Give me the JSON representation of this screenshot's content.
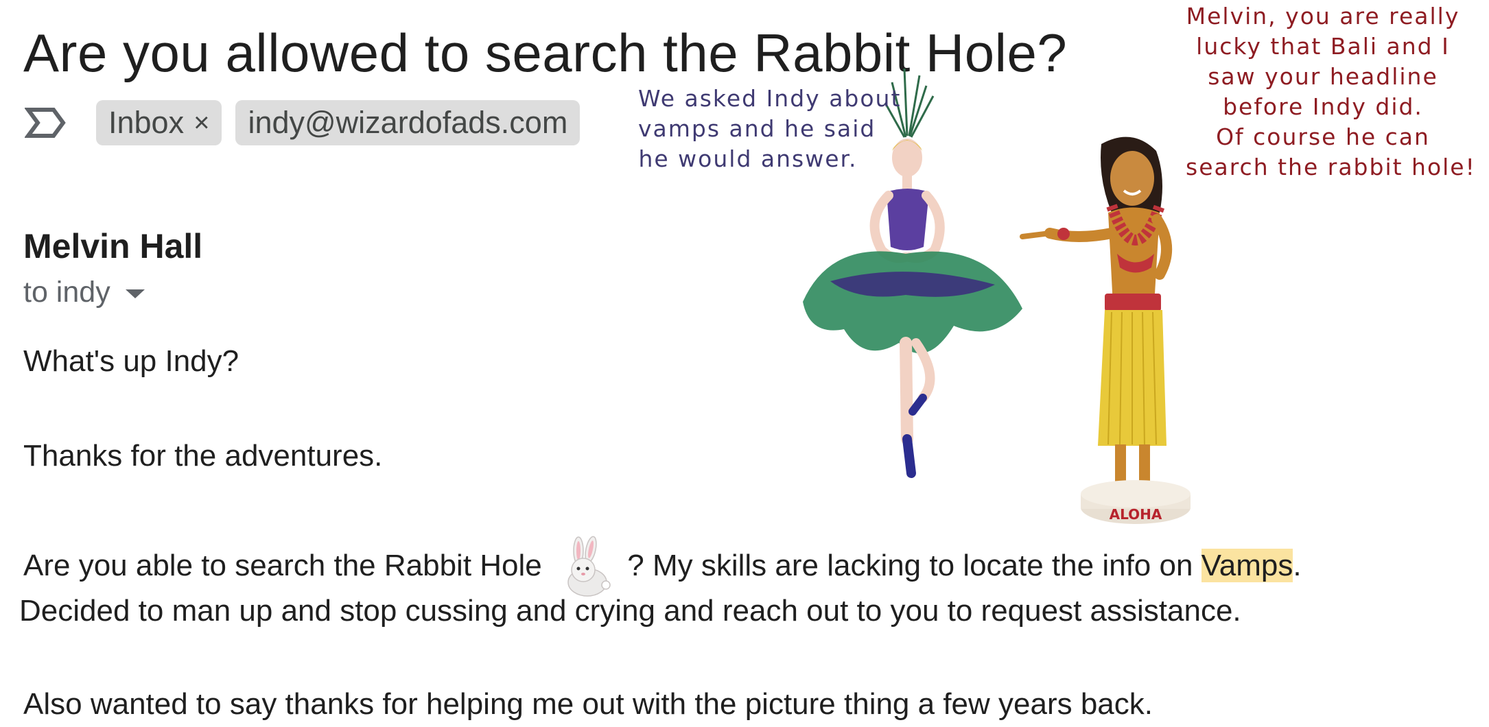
{
  "email": {
    "subject": "Are you allowed to search the Rabbit Hole?",
    "labels": [
      {
        "text": "Inbox",
        "removable": true
      },
      {
        "text": "indy@wizardofads.com",
        "removable": false
      }
    ],
    "remove_glyph": "×",
    "sender": "Melvin Hall",
    "recipients": "to indy",
    "body": {
      "greeting": "What's up Indy?",
      "thanks": "Thanks for the adventures.",
      "question_before": "Are you able to search the Rabbit Hole",
      "question_after": "? My skills are lacking to locate the info on ",
      "highlight": "Vamps",
      "question_end": ".",
      "decided": "Decided to man up and stop cussing and crying and reach out to you to request assistance.",
      "also": "Also wanted to say thanks for helping me out with the picture thing a few years back."
    }
  },
  "overlay": {
    "ballerina_caption": [
      "We asked Indy about",
      "vamps and he said",
      "he would answer."
    ],
    "hula_caption": [
      "Melvin, you are really",
      "lucky that Bali and I",
      "saw your headline",
      "before Indy did.",
      "Of course he can",
      "search the rabbit hole!"
    ],
    "hula_base_text": "ALOHA"
  },
  "icons": {
    "importance": "importance-marker-icon",
    "rabbit": "rabbit-emoji-icon",
    "dropdown": "caret-down-icon"
  },
  "colors": {
    "chip_bg": "#dddddd",
    "highlight": "#fbe3a0",
    "left_caption": "#3f3a72",
    "right_caption": "#8e1c22"
  }
}
